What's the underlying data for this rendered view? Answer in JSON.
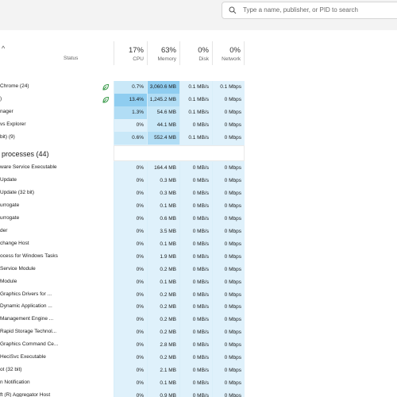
{
  "search": {
    "placeholder": "Type a name, publisher, or PID to search"
  },
  "columns": {
    "status": "Status",
    "cpu": {
      "pct": "17%",
      "label": "CPU"
    },
    "memory": {
      "pct": "63%",
      "label": "Memory"
    },
    "disk": {
      "pct": "0%",
      "label": "Disk"
    },
    "network": {
      "pct": "0%",
      "label": "Network"
    }
  },
  "apps": [
    {
      "name": "Chrome (24)",
      "eco": true,
      "cpu": "0.7%",
      "mem": "3,060.6 MB",
      "disk": "0.1 MB/s",
      "net": "0.1 Mbps",
      "cpuHeat": 1,
      "memHeat": 3
    },
    {
      "name": ")",
      "eco": true,
      "cpu": "13.4%",
      "mem": "1,245.2 MB",
      "disk": "0.1 MB/s",
      "net": "0 Mbps",
      "cpuHeat": 3,
      "memHeat": 2
    },
    {
      "name": "nager",
      "eco": false,
      "cpu": "1.3%",
      "mem": "54.6 MB",
      "disk": "0.1 MB/s",
      "net": "0 Mbps",
      "cpuHeat": 2,
      "memHeat": 1
    },
    {
      "name": "vs Explorer",
      "eco": false,
      "cpu": "0%",
      "mem": "44.1 MB",
      "disk": "0 MB/s",
      "net": "0 Mbps",
      "cpuHeat": 0,
      "memHeat": 1
    },
    {
      "name": "bit) (9)",
      "eco": false,
      "cpu": "0.6%",
      "mem": "552.4 MB",
      "disk": "0.1 MB/s",
      "net": "0 Mbps",
      "cpuHeat": 1,
      "memHeat": 2
    }
  ],
  "background": {
    "title": "processes (44)",
    "rows": [
      {
        "name": "ware Service Executable",
        "cpu": "0%",
        "mem": "164.4 MB",
        "disk": "0 MB/s",
        "net": "0 Mbps"
      },
      {
        "name": "Update",
        "cpu": "0%",
        "mem": "0.3 MB",
        "disk": "0 MB/s",
        "net": "0 Mbps"
      },
      {
        "name": "Update (32 bit)",
        "cpu": "0%",
        "mem": "0.3 MB",
        "disk": "0 MB/s",
        "net": "0 Mbps"
      },
      {
        "name": "urrogate",
        "cpu": "0%",
        "mem": "0.1 MB",
        "disk": "0 MB/s",
        "net": "0 Mbps"
      },
      {
        "name": "urrogate",
        "cpu": "0%",
        "mem": "0.6 MB",
        "disk": "0 MB/s",
        "net": "0 Mbps"
      },
      {
        "name": "der",
        "cpu": "0%",
        "mem": "3.5 MB",
        "disk": "0 MB/s",
        "net": "0 Mbps"
      },
      {
        "name": "change Host",
        "cpu": "0%",
        "mem": "0.1 MB",
        "disk": "0 MB/s",
        "net": "0 Mbps"
      },
      {
        "name": "ocess for Windows Tasks",
        "cpu": "0%",
        "mem": "1.9 MB",
        "disk": "0 MB/s",
        "net": "0 Mbps"
      },
      {
        "name": "Service Module",
        "cpu": "0%",
        "mem": "0.2 MB",
        "disk": "0 MB/s",
        "net": "0 Mbps"
      },
      {
        "name": "Module",
        "cpu": "0%",
        "mem": "0.1 MB",
        "disk": "0 MB/s",
        "net": "0 Mbps"
      },
      {
        "name": "Graphics Drivers for ...",
        "cpu": "0%",
        "mem": "0.2 MB",
        "disk": "0 MB/s",
        "net": "0 Mbps"
      },
      {
        "name": "Dynamic Application ...",
        "cpu": "0%",
        "mem": "0.2 MB",
        "disk": "0 MB/s",
        "net": "0 Mbps"
      },
      {
        "name": "Management Engine ...",
        "cpu": "0%",
        "mem": "0.2 MB",
        "disk": "0 MB/s",
        "net": "0 Mbps"
      },
      {
        "name": "Rapid Storage Technol...",
        "cpu": "0%",
        "mem": "0.2 MB",
        "disk": "0 MB/s",
        "net": "0 Mbps"
      },
      {
        "name": "Graphics Command Ce...",
        "cpu": "0%",
        "mem": "2.8 MB",
        "disk": "0 MB/s",
        "net": "0 Mbps"
      },
      {
        "name": "HeciSvc Executable",
        "cpu": "0%",
        "mem": "0.2 MB",
        "disk": "0 MB/s",
        "net": "0 Mbps"
      },
      {
        "name": "ot (32 bit)",
        "cpu": "0%",
        "mem": "2.1 MB",
        "disk": "0 MB/s",
        "net": "0 Mbps"
      },
      {
        "name": "n Notification",
        "cpu": "0%",
        "mem": "0.1 MB",
        "disk": "0 MB/s",
        "net": "0 Mbps"
      },
      {
        "name": "ft (R) Aggregator Host",
        "cpu": "0%",
        "mem": "0.9 MB",
        "disk": "0 MB/s",
        "net": "0 Mbps"
      }
    ]
  },
  "colors": {
    "heat0": "#dff1fb",
    "heat1": "#c9e8f8",
    "heat2": "#b1ddf5",
    "heat3": "#8fcdf0",
    "bg_cell": "#dff1fb",
    "eco": "#3a9a4a"
  }
}
